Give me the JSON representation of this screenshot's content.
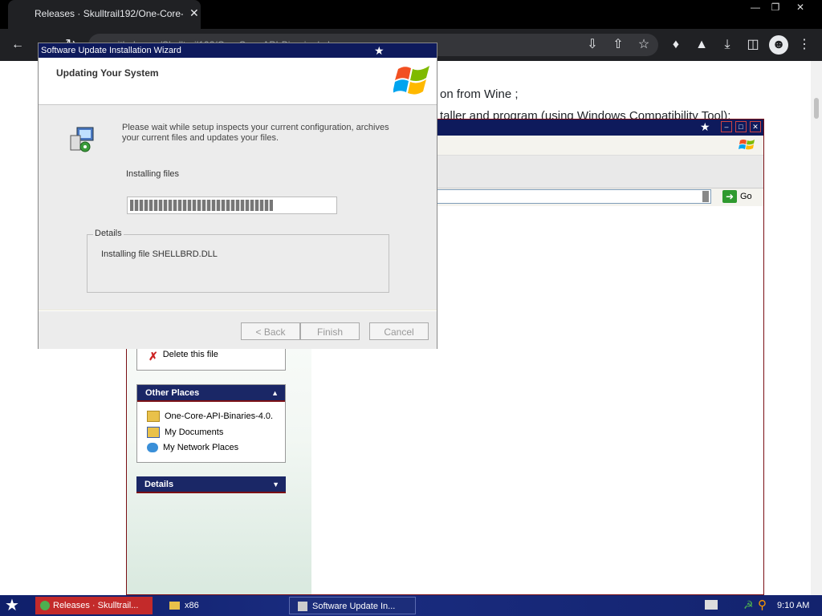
{
  "browser": {
    "tab_title": "Releases · Skulltrail192/One-Core-A",
    "tab_close": "✕",
    "window_controls": [
      "—",
      "❐",
      "✕"
    ],
    "address": "github.com/Skulltrail192/One-Core-API-Binaries/releases"
  },
  "page": {
    "line1": "on from Wine ;",
    "line2": "taller and program (using Windows Compatibility Tool);"
  },
  "explorer": {
    "go_label": "Go",
    "file_tasks_item": "Delete this file",
    "other_places_title": "Other Places",
    "other_places_items": [
      "One-Core-API-Binaries-4.0.",
      "My Documents",
      "My Network Places"
    ],
    "details_title": "Details"
  },
  "wizard": {
    "title": "Software Update Installation Wizard",
    "header_title": "Updating Your System",
    "description": "Please wait while setup inspects your current configuration, archives your current files and updates your files.",
    "status_label": "Installing files",
    "progress": 0.7,
    "details_legend": "Details",
    "details_text": "Installing file SHELLBRD.DLL",
    "buttons": {
      "back": "< Back",
      "finish": "Finish",
      "cancel": "Cancel"
    }
  },
  "taskbar": {
    "items": [
      "Releases · Skulltrail...",
      "x86",
      "Software Update In..."
    ],
    "clock": "9:10 AM"
  },
  "colors": {
    "titlebar_blue": "#0e1a5c",
    "accent_red": "#7a0f14",
    "taskbar_blue": "#13236e"
  }
}
